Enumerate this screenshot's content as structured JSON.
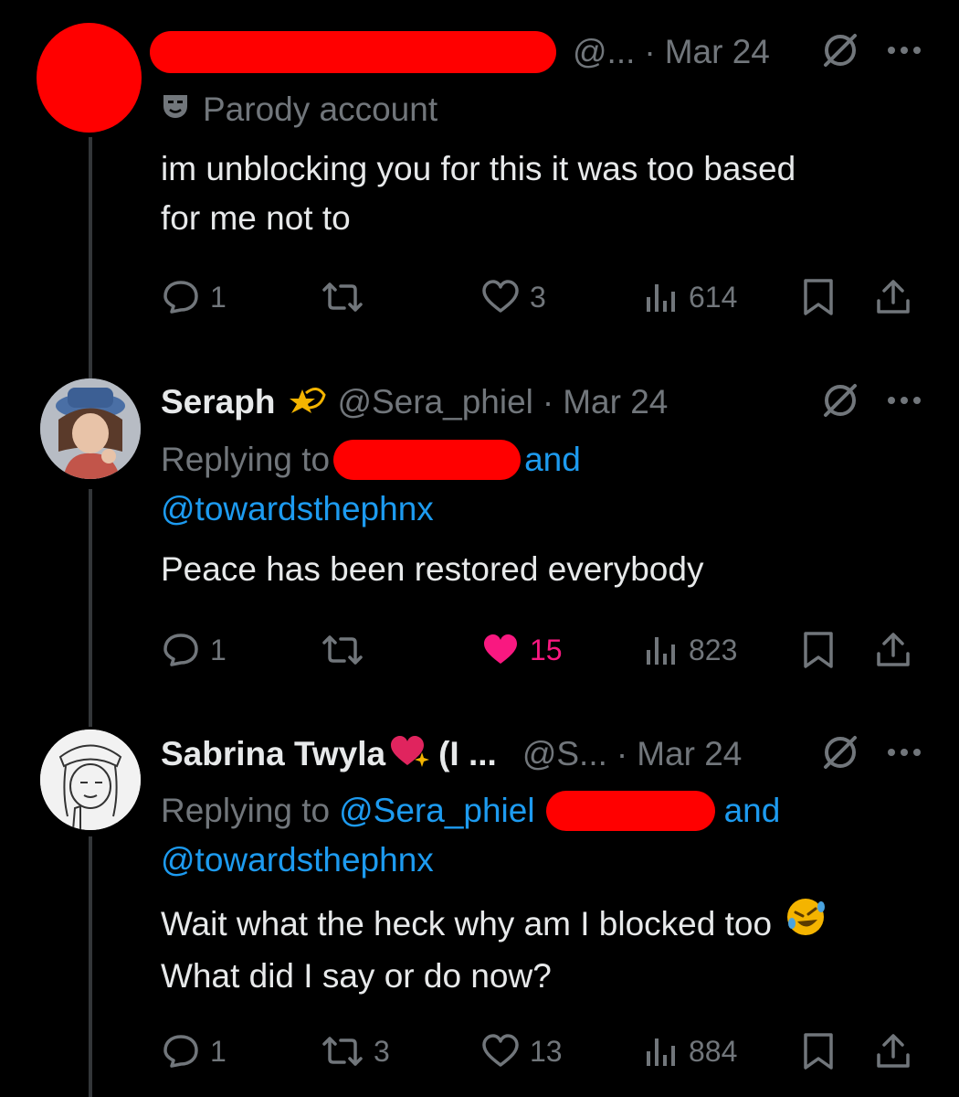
{
  "tweets": [
    {
      "name": "",
      "handle": "@...",
      "sep": "·",
      "date": "Mar 24",
      "badge": "Parody account",
      "text_lines": [
        "im unblocking you for this it was too based",
        "for me not to"
      ],
      "replies": "1",
      "retweets": "",
      "likes": "3",
      "views": "614"
    },
    {
      "name": "Seraph",
      "handle": "@Sera_phiel",
      "sep": "·",
      "date": "Mar 24",
      "replying_prefix": "Replying to",
      "replying_and": "and",
      "replying_mention2": "@towardsthephnx",
      "text": "Peace has been restored everybody",
      "replies": "1",
      "retweets": "",
      "likes": "15",
      "views": "823"
    },
    {
      "name": "Sabrina Twyla",
      "name_suffix": "(I ...",
      "handle": "@S...",
      "sep": "·",
      "date": "Mar 24",
      "replying_prefix": "Replying to",
      "replying_mention1": "@Sera_phiel",
      "replying_and": "and",
      "replying_mention2": "@towardsthephnx",
      "text_lines": [
        "Wait what the heck why am I blocked too",
        "What did I say or do now?"
      ],
      "replies": "1",
      "retweets": "3",
      "likes": "13",
      "views": "884"
    }
  ],
  "colors": {
    "like_active": "#f91880",
    "link": "#1d9bf0",
    "muted": "#71767b",
    "redaction": "#ff0000"
  }
}
